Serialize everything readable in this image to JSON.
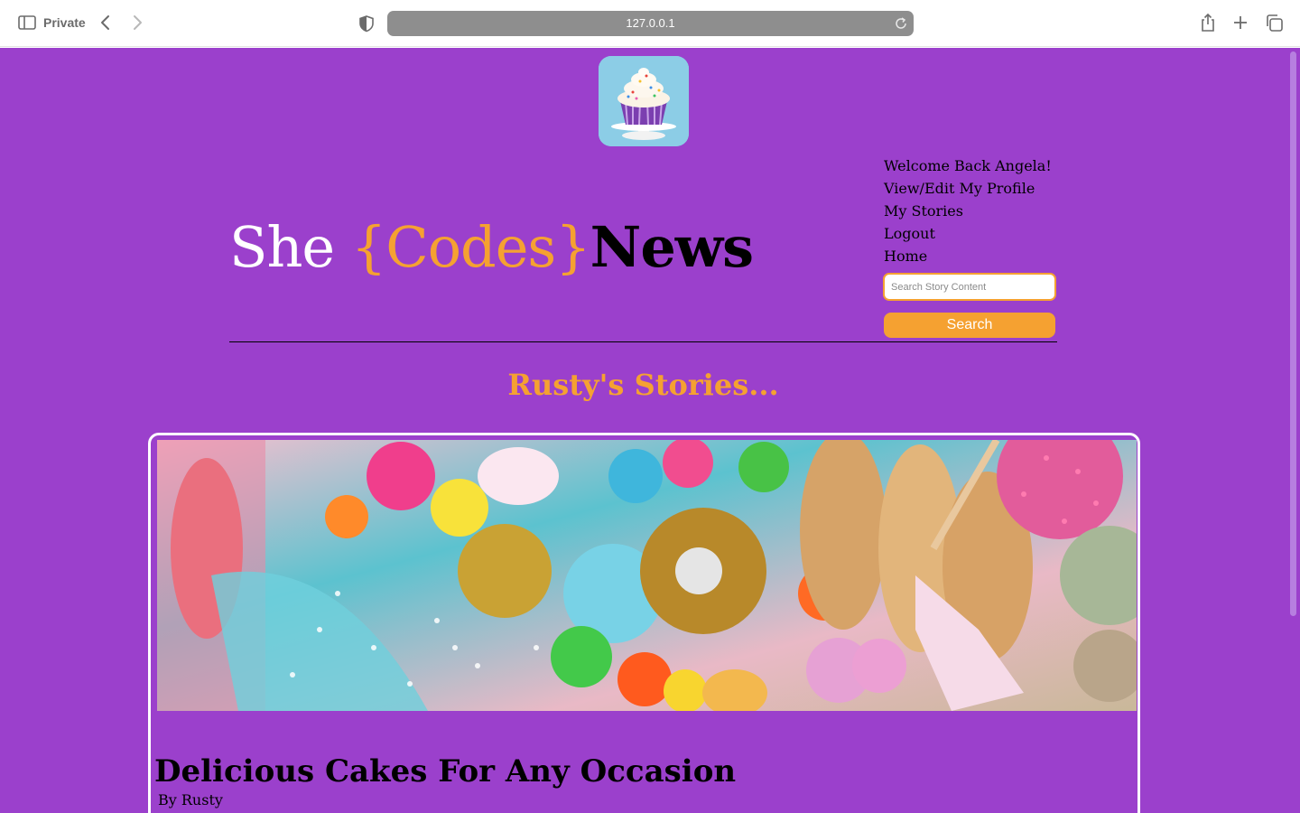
{
  "browser": {
    "private_label": "Private",
    "url": "127.0.0.1"
  },
  "site": {
    "title_she": "She ",
    "title_codes": "{Codes}",
    "title_news": "News",
    "colors": {
      "background": "#9b40cc",
      "accent": "#f5a131",
      "text": "#000000"
    }
  },
  "nav": {
    "welcome": "Welcome Back Angela!",
    "profile": "View/Edit My Profile",
    "stories": "My Stories",
    "logout": "Logout",
    "home": "Home"
  },
  "search": {
    "placeholder": "Search Story Content",
    "button_label": "Search"
  },
  "section": {
    "title": "Rusty's Stories..."
  },
  "story": {
    "title": "Delicious Cakes For Any Occasion",
    "author": "By Rusty"
  }
}
